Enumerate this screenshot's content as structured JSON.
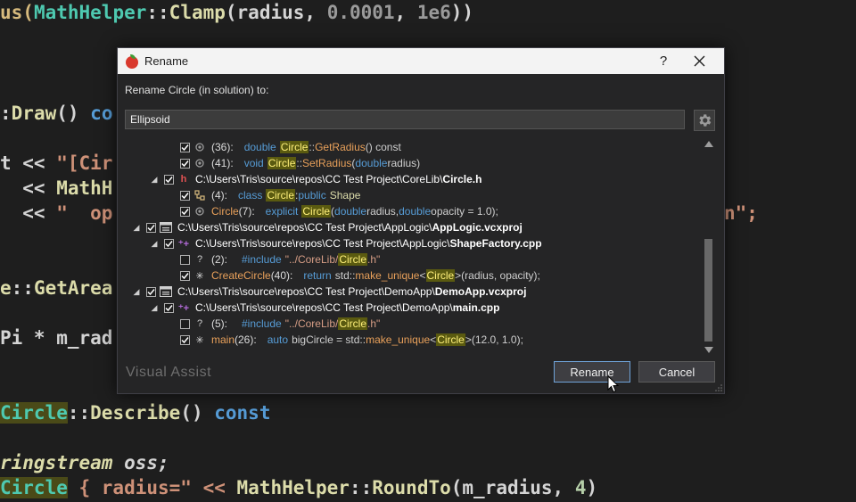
{
  "background_code": {
    "line1": {
      "a": "us(",
      "b": "MathHelper",
      "c": "::",
      "d": "Clamp",
      "e": "(radius, ",
      "f": "0.0001",
      "g": ", ",
      "h": "1e6",
      "i": "))"
    },
    "line2": {
      "a": ":",
      "b": "Draw",
      "c": "() ",
      "d": "co"
    },
    "line3": {
      "a": "t << ",
      "b": "\"[Cir"
    },
    "line3r": {
      "a": "n\";"
    },
    "line4": {
      "a": "  << ",
      "b": "MathH"
    },
    "line5": {
      "a": "  << ",
      "b": "\"  op"
    },
    "line6": {
      "a": "e",
      "b": "::",
      "c": "GetArea"
    },
    "line7": {
      "a": "Pi * ",
      "b": "m_rad"
    },
    "line8": {
      "a": "Circle",
      "b": "::",
      "c": "Describe",
      "d": "() ",
      "e": "const"
    },
    "line9": {
      "a": "ringstream",
      "b": " oss;"
    },
    "line10": {
      "a": "Circle",
      "b": " { radius=\" << ",
      "c": "MathHelper",
      "d": "::",
      "e": "RoundTo",
      "f": "(m_radius, ",
      "g": "4",
      "h": ")"
    }
  },
  "dialog": {
    "title": "Rename",
    "help": "?",
    "close": "✕",
    "prompt": "Rename Circle (in solution) to:",
    "input_value": "Ellipsoid",
    "brand": "Visual Assist",
    "rename_label": "Rename",
    "cancel_label": "Cancel"
  },
  "tree": {
    "r1": {
      "loc": "(36):",
      "a": "double",
      "b": "Circle",
      "c": "::",
      "d": "GetRadius",
      "e": "() const"
    },
    "r2": {
      "loc": "(41):",
      "a": "void",
      "b": "Circle",
      "c": "::",
      "d": "SetRadius",
      "e": "(",
      "f": "double",
      "g": " radius)"
    },
    "r3": {
      "path": "C:\\Users\\Tris\\source\\repos\\CC Test Project\\CoreLib\\ ",
      "file": "Circle.h"
    },
    "r4": {
      "loc": "(4):",
      "a": "class",
      "b": "Circle",
      "c": " : ",
      "d": "public",
      "e": "Shape"
    },
    "r5": {
      "ctx": "Circle",
      "loc": " (7):",
      "a": "explicit",
      "b": "Circle",
      "c": "(",
      "d": "double",
      "e": " radius, ",
      "f": "double",
      "g": " opacity = 1.0);"
    },
    "r6": {
      "path": "C:\\Users\\Tris\\source\\repos\\CC Test Project\\AppLogic\\ ",
      "file": "AppLogic.vcxproj"
    },
    "r7": {
      "path": "C:\\Users\\Tris\\source\\repos\\CC Test Project\\AppLogic\\ ",
      "file": "ShapeFactory.cpp"
    },
    "r8": {
      "loc": "(2):",
      "a": "#include",
      "b": "\"../CoreLib/",
      "c": "Circle",
      "d": ".h\""
    },
    "r9": {
      "ctx": "CreateCircle",
      "loc": " (40):",
      "a": "return",
      "b": "std::",
      "c": "make_unique",
      "d": "<",
      "e": "Circle",
      "f": ">(radius, opacity);"
    },
    "r10": {
      "path": "C:\\Users\\Tris\\source\\repos\\CC Test Project\\DemoApp\\ ",
      "file": "DemoApp.vcxproj"
    },
    "r11": {
      "path": "C:\\Users\\Tris\\source\\repos\\CC Test Project\\DemoApp\\ ",
      "file": "main.cpp"
    },
    "r12": {
      "loc": "(5):",
      "a": "#include",
      "b": "\"../CoreLib/",
      "c": "Circle",
      "d": ".h\""
    },
    "r13": {
      "ctx": "main",
      "loc": " (26):",
      "a": "auto",
      "b": "bigCircle = std::",
      "c": "make_unique",
      "d": "<",
      "e": "Circle",
      "f": ">(12.0, 1.0);"
    }
  },
  "colors": {
    "accent_border": "#6fa3d9",
    "highlight": "#5a5a10"
  }
}
